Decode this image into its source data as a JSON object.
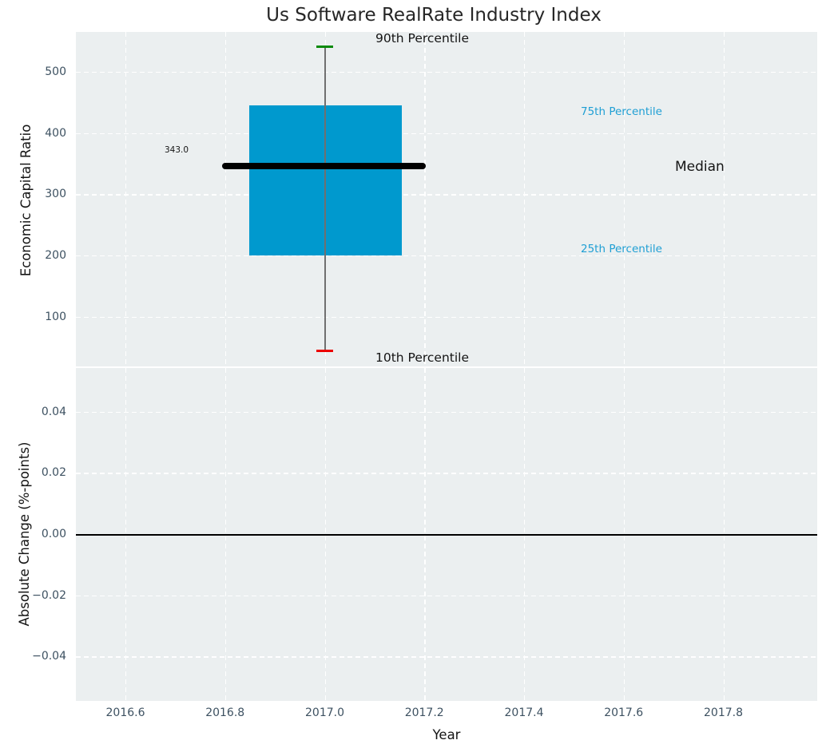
{
  "title": "Us Software RealRate Industry Index",
  "chart_data": [
    {
      "type": "boxplot",
      "title": "Us Software RealRate Industry Index",
      "ylabel": "Economic Capital Ratio",
      "xlabel": "Year",
      "x": 2017.0,
      "box": {
        "p10": 45,
        "p25": 200,
        "median": 343.0,
        "p75": 445,
        "p90": 540
      },
      "median_data_label": "343.0",
      "yticks": [
        100,
        200,
        300,
        400,
        500
      ],
      "ylim": [
        20,
        565
      ],
      "xlim": [
        2016.5,
        2018.0
      ],
      "grid": true,
      "legend_position": "none",
      "annotations": [
        "90th Percentile",
        "75th Percentile",
        "Median",
        "25th Percentile",
        "10th Percentile"
      ]
    },
    {
      "type": "line",
      "ylabel": "Absolute Change (%-points)",
      "xlabel": "Year",
      "series": [],
      "zero_line": 0.0,
      "yticks": [
        -0.04,
        -0.02,
        0.0,
        0.02,
        0.04
      ],
      "ylim": [
        -0.055,
        0.057
      ],
      "xticks": [
        2016.6,
        2016.8,
        2017.0,
        2017.2,
        2017.4,
        2017.6,
        2017.8
      ],
      "xlim": [
        2016.5,
        2018.0
      ],
      "grid": true
    }
  ],
  "axes1": {
    "ylabel": "Economic Capital Ratio",
    "yticks": [
      "500",
      "400",
      "300",
      "200",
      "100"
    ],
    "annotations": {
      "p90": "90th Percentile",
      "p75": "75th Percentile",
      "median": "Median",
      "median_value": "343.0",
      "p25": "25th Percentile",
      "p10": "10th Percentile"
    }
  },
  "axes2": {
    "ylabel": "Absolute Change (%-points)",
    "xlabel": "Year",
    "yticks": [
      "0.04",
      "0.02",
      "0.00",
      "−0.02",
      "−0.04"
    ],
    "xticks": [
      "2016.6",
      "2016.8",
      "2017.0",
      "2017.2",
      "2017.4",
      "2017.6",
      "2017.8"
    ]
  },
  "colors": {
    "box_fill": "#0099ce",
    "percentile_label": "#1f9fd4",
    "p90_cap": "#0a8a0a",
    "p10_cap": "#ec0000",
    "median_line": "#000000",
    "axes_bg": "#ebeff0",
    "tick_label": "#3d5161",
    "grid_line": "#ffffff",
    "whisker": "#707070"
  }
}
